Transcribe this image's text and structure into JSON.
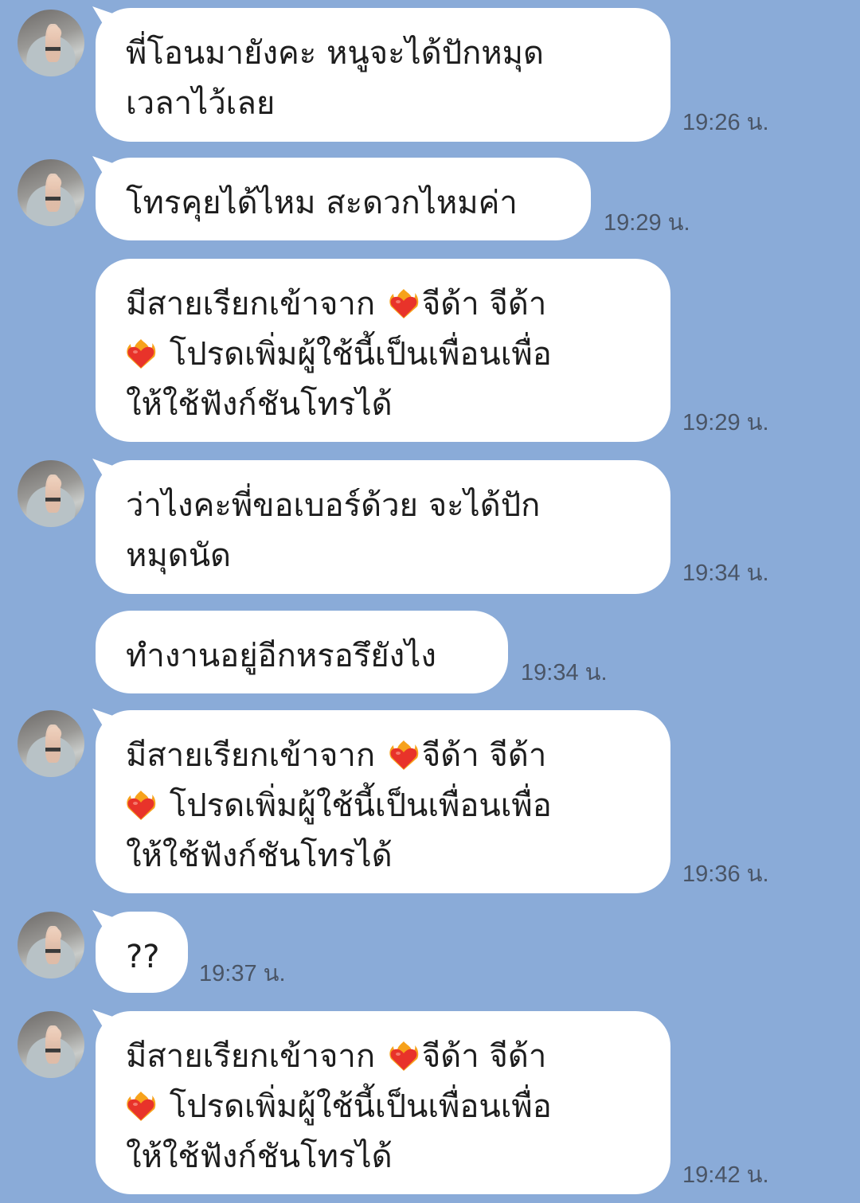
{
  "messages": [
    {
      "lines": [
        "พี่โอนมายังคะ หนูจะได้ปักหมุด",
        "เวลาไว้เลย"
      ],
      "time": "19:26 น."
    },
    {
      "lines": [
        "โทรคุยได้ไหม สะดวกไหมค่า"
      ],
      "time": "19:29 น."
    },
    {
      "call_notice": {
        "before": "มีสายเรียกเข้าจาก",
        "name": "จีด้า จีด้า",
        "line2": "โปรดเพิ่มผู้ใช้นี้เป็นเพื่อนเพื่อ",
        "line3": "ให้ใช้ฟังก์ชันโทรได้"
      },
      "time": "19:29 น."
    },
    {
      "lines": [
        "ว่าไงคะพี่ขอเบอร์ด้วย จะได้ปัก",
        "หมุดนัด"
      ],
      "time": "19:34 น."
    },
    {
      "lines": [
        "ทำงานอยู่อีกหรอรึยังไง"
      ],
      "time": "19:34 น."
    },
    {
      "call_notice": {
        "before": "มีสายเรียกเข้าจาก",
        "name": "จีด้า จีด้า",
        "line2": "โปรดเพิ่มผู้ใช้นี้เป็นเพื่อนเพื่อ",
        "line3": "ให้ใช้ฟังก์ชันโทรได้"
      },
      "time": "19:36 น."
    },
    {
      "lines": [
        "??"
      ],
      "time": "19:37 น."
    },
    {
      "call_notice": {
        "before": "มีสายเรียกเข้าจาก",
        "name": "จีด้า จีด้า",
        "line2": "โปรดเพิ่มผู้ใช้นี้เป็นเพื่อนเพื่อ",
        "line3": "ให้ใช้ฟังก์ชันโทรได้"
      },
      "time": "19:42 น."
    }
  ],
  "icons": {
    "heart": "heart-on-fire-icon",
    "avatar": "contact-avatar"
  },
  "colors": {
    "background": "#8aabd8",
    "bubble": "#ffffff",
    "heart": "#e8332a",
    "flame": "#f7a21b"
  }
}
